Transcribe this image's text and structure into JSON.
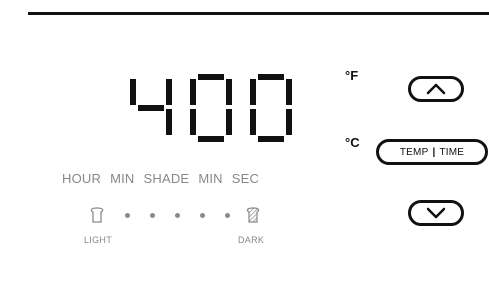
{
  "display": {
    "value": "400",
    "digit_color": "#111111"
  },
  "units": {
    "fahrenheit": "°F",
    "celsius": "°C"
  },
  "controls": {
    "up_icon": "chevron-up-icon",
    "down_icon": "chevron-down-icon",
    "temp_label": "TEMP",
    "separator": "|",
    "time_label": "TIME"
  },
  "modes": [
    "HOUR",
    "MIN",
    "SHADE",
    "MIN",
    "SEC"
  ],
  "shade": {
    "light_label": "LIGHT",
    "dark_label": "DARK",
    "light_icon": "light-toast-icon",
    "dark_icon": "dark-toast-icon",
    "dot_count": 5
  },
  "colors": {
    "accent": "#111111",
    "muted": "#888888"
  }
}
